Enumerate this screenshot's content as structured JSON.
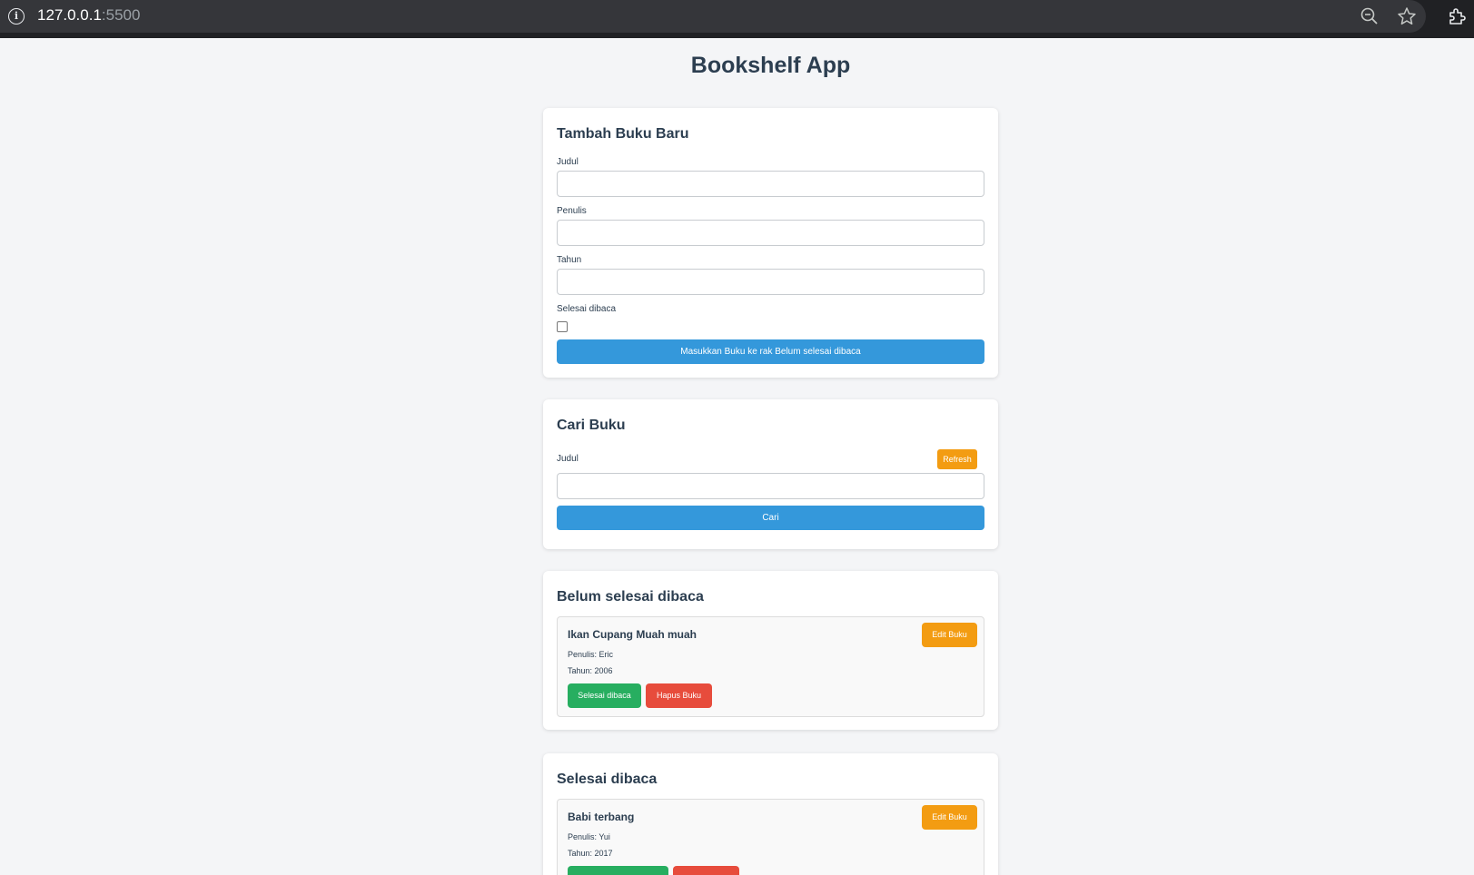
{
  "browser": {
    "host": "127.0.0.1",
    "port": ":5500"
  },
  "app_title": "Bookshelf App",
  "add_form": {
    "heading": "Tambah Buku Baru",
    "title_label": "Judul",
    "author_label": "Penulis",
    "year_label": "Tahun",
    "complete_label": "Selesai dibaca",
    "submit_label": "Masukkan Buku ke rak Belum selesai dibaca"
  },
  "search": {
    "heading": "Cari Buku",
    "title_label": "Judul",
    "refresh_label": "Refresh",
    "submit_label": "Cari"
  },
  "incomplete_shelf": {
    "heading": "Belum selesai dibaca",
    "books": [
      {
        "title": "Ikan Cupang Muah muah",
        "author": "Penulis: Eric",
        "year": "Tahun: 2006",
        "edit_label": "Edit Buku",
        "toggle_label": "Selesai dibaca",
        "delete_label": "Hapus Buku"
      }
    ]
  },
  "complete_shelf": {
    "heading": "Selesai dibaca",
    "books": [
      {
        "title": "Babi terbang",
        "author": "Penulis: Yui",
        "year": "Tahun: 2017",
        "edit_label": "Edit Buku"
      }
    ]
  }
}
